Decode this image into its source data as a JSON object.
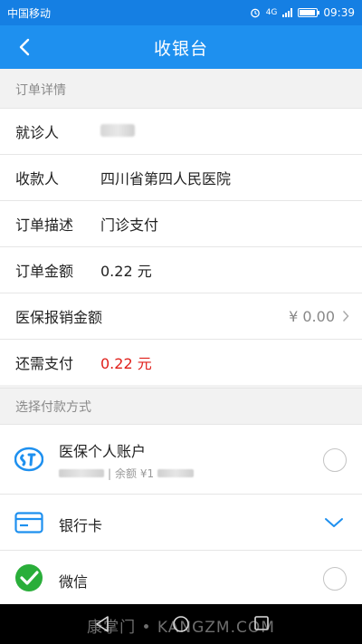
{
  "status_bar": {
    "carrier": "中国移动",
    "network": "4G",
    "time": "09:39"
  },
  "header": {
    "title": "收银台",
    "back_icon": "chevron-left-icon"
  },
  "order_section": {
    "label": "订单详情",
    "rows": [
      {
        "label": "就诊人",
        "value": ""
      },
      {
        "label": "收款人",
        "value": "四川省第四人民医院"
      },
      {
        "label": "订单描述",
        "value": "门诊支付"
      },
      {
        "label": "订单金额",
        "value": "0.22 元"
      },
      {
        "label": "医保报销金额",
        "value": "¥ 0.00"
      },
      {
        "label": "还需支付",
        "value": "0.22 元"
      }
    ]
  },
  "payment_section": {
    "label": "选择付款方式",
    "methods": [
      {
        "title": "医保个人账户",
        "sub_sep": "|",
        "sub_balance": "余额 ¥1",
        "icon": "social-insurance-icon"
      },
      {
        "title": "银行卡",
        "icon": "bank-card-icon"
      },
      {
        "title": "微信",
        "icon": "wechat-icon"
      }
    ]
  },
  "watermark": "康掌门 • KANGZM.COM",
  "colors": {
    "header": "#1e90ef",
    "status_bar": "#157fe3",
    "amount_due": "#e0201b",
    "accent": "#1e90ef",
    "wechat": "#2aae3a"
  }
}
